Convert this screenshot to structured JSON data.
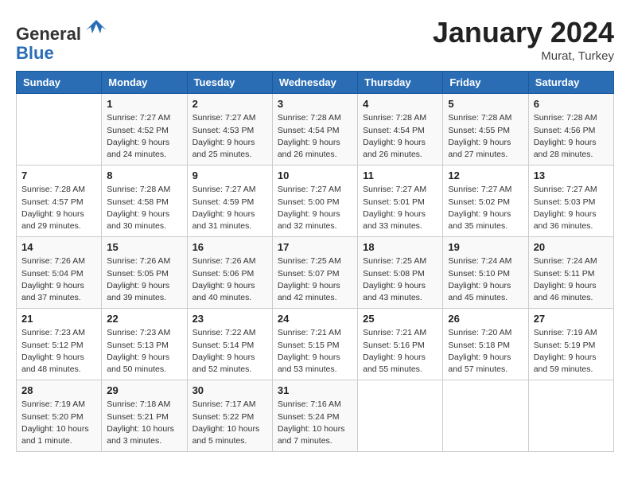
{
  "header": {
    "logo_line1": "General",
    "logo_line2": "Blue",
    "month": "January 2024",
    "location": "Murat, Turkey"
  },
  "weekdays": [
    "Sunday",
    "Monday",
    "Tuesday",
    "Wednesday",
    "Thursday",
    "Friday",
    "Saturday"
  ],
  "weeks": [
    [
      {
        "day": "",
        "sunrise": "",
        "sunset": "",
        "daylight": ""
      },
      {
        "day": "1",
        "sunrise": "Sunrise: 7:27 AM",
        "sunset": "Sunset: 4:52 PM",
        "daylight": "Daylight: 9 hours and 24 minutes."
      },
      {
        "day": "2",
        "sunrise": "Sunrise: 7:27 AM",
        "sunset": "Sunset: 4:53 PM",
        "daylight": "Daylight: 9 hours and 25 minutes."
      },
      {
        "day": "3",
        "sunrise": "Sunrise: 7:28 AM",
        "sunset": "Sunset: 4:54 PM",
        "daylight": "Daylight: 9 hours and 26 minutes."
      },
      {
        "day": "4",
        "sunrise": "Sunrise: 7:28 AM",
        "sunset": "Sunset: 4:54 PM",
        "daylight": "Daylight: 9 hours and 26 minutes."
      },
      {
        "day": "5",
        "sunrise": "Sunrise: 7:28 AM",
        "sunset": "Sunset: 4:55 PM",
        "daylight": "Daylight: 9 hours and 27 minutes."
      },
      {
        "day": "6",
        "sunrise": "Sunrise: 7:28 AM",
        "sunset": "Sunset: 4:56 PM",
        "daylight": "Daylight: 9 hours and 28 minutes."
      }
    ],
    [
      {
        "day": "7",
        "sunrise": "Sunrise: 7:28 AM",
        "sunset": "Sunset: 4:57 PM",
        "daylight": "Daylight: 9 hours and 29 minutes."
      },
      {
        "day": "8",
        "sunrise": "Sunrise: 7:28 AM",
        "sunset": "Sunset: 4:58 PM",
        "daylight": "Daylight: 9 hours and 30 minutes."
      },
      {
        "day": "9",
        "sunrise": "Sunrise: 7:27 AM",
        "sunset": "Sunset: 4:59 PM",
        "daylight": "Daylight: 9 hours and 31 minutes."
      },
      {
        "day": "10",
        "sunrise": "Sunrise: 7:27 AM",
        "sunset": "Sunset: 5:00 PM",
        "daylight": "Daylight: 9 hours and 32 minutes."
      },
      {
        "day": "11",
        "sunrise": "Sunrise: 7:27 AM",
        "sunset": "Sunset: 5:01 PM",
        "daylight": "Daylight: 9 hours and 33 minutes."
      },
      {
        "day": "12",
        "sunrise": "Sunrise: 7:27 AM",
        "sunset": "Sunset: 5:02 PM",
        "daylight": "Daylight: 9 hours and 35 minutes."
      },
      {
        "day": "13",
        "sunrise": "Sunrise: 7:27 AM",
        "sunset": "Sunset: 5:03 PM",
        "daylight": "Daylight: 9 hours and 36 minutes."
      }
    ],
    [
      {
        "day": "14",
        "sunrise": "Sunrise: 7:26 AM",
        "sunset": "Sunset: 5:04 PM",
        "daylight": "Daylight: 9 hours and 37 minutes."
      },
      {
        "day": "15",
        "sunrise": "Sunrise: 7:26 AM",
        "sunset": "Sunset: 5:05 PM",
        "daylight": "Daylight: 9 hours and 39 minutes."
      },
      {
        "day": "16",
        "sunrise": "Sunrise: 7:26 AM",
        "sunset": "Sunset: 5:06 PM",
        "daylight": "Daylight: 9 hours and 40 minutes."
      },
      {
        "day": "17",
        "sunrise": "Sunrise: 7:25 AM",
        "sunset": "Sunset: 5:07 PM",
        "daylight": "Daylight: 9 hours and 42 minutes."
      },
      {
        "day": "18",
        "sunrise": "Sunrise: 7:25 AM",
        "sunset": "Sunset: 5:08 PM",
        "daylight": "Daylight: 9 hours and 43 minutes."
      },
      {
        "day": "19",
        "sunrise": "Sunrise: 7:24 AM",
        "sunset": "Sunset: 5:10 PM",
        "daylight": "Daylight: 9 hours and 45 minutes."
      },
      {
        "day": "20",
        "sunrise": "Sunrise: 7:24 AM",
        "sunset": "Sunset: 5:11 PM",
        "daylight": "Daylight: 9 hours and 46 minutes."
      }
    ],
    [
      {
        "day": "21",
        "sunrise": "Sunrise: 7:23 AM",
        "sunset": "Sunset: 5:12 PM",
        "daylight": "Daylight: 9 hours and 48 minutes."
      },
      {
        "day": "22",
        "sunrise": "Sunrise: 7:23 AM",
        "sunset": "Sunset: 5:13 PM",
        "daylight": "Daylight: 9 hours and 50 minutes."
      },
      {
        "day": "23",
        "sunrise": "Sunrise: 7:22 AM",
        "sunset": "Sunset: 5:14 PM",
        "daylight": "Daylight: 9 hours and 52 minutes."
      },
      {
        "day": "24",
        "sunrise": "Sunrise: 7:21 AM",
        "sunset": "Sunset: 5:15 PM",
        "daylight": "Daylight: 9 hours and 53 minutes."
      },
      {
        "day": "25",
        "sunrise": "Sunrise: 7:21 AM",
        "sunset": "Sunset: 5:16 PM",
        "daylight": "Daylight: 9 hours and 55 minutes."
      },
      {
        "day": "26",
        "sunrise": "Sunrise: 7:20 AM",
        "sunset": "Sunset: 5:18 PM",
        "daylight": "Daylight: 9 hours and 57 minutes."
      },
      {
        "day": "27",
        "sunrise": "Sunrise: 7:19 AM",
        "sunset": "Sunset: 5:19 PM",
        "daylight": "Daylight: 9 hours and 59 minutes."
      }
    ],
    [
      {
        "day": "28",
        "sunrise": "Sunrise: 7:19 AM",
        "sunset": "Sunset: 5:20 PM",
        "daylight": "Daylight: 10 hours and 1 minute."
      },
      {
        "day": "29",
        "sunrise": "Sunrise: 7:18 AM",
        "sunset": "Sunset: 5:21 PM",
        "daylight": "Daylight: 10 hours and 3 minutes."
      },
      {
        "day": "30",
        "sunrise": "Sunrise: 7:17 AM",
        "sunset": "Sunset: 5:22 PM",
        "daylight": "Daylight: 10 hours and 5 minutes."
      },
      {
        "day": "31",
        "sunrise": "Sunrise: 7:16 AM",
        "sunset": "Sunset: 5:24 PM",
        "daylight": "Daylight: 10 hours and 7 minutes."
      },
      {
        "day": "",
        "sunrise": "",
        "sunset": "",
        "daylight": ""
      },
      {
        "day": "",
        "sunrise": "",
        "sunset": "",
        "daylight": ""
      },
      {
        "day": "",
        "sunrise": "",
        "sunset": "",
        "daylight": ""
      }
    ]
  ]
}
